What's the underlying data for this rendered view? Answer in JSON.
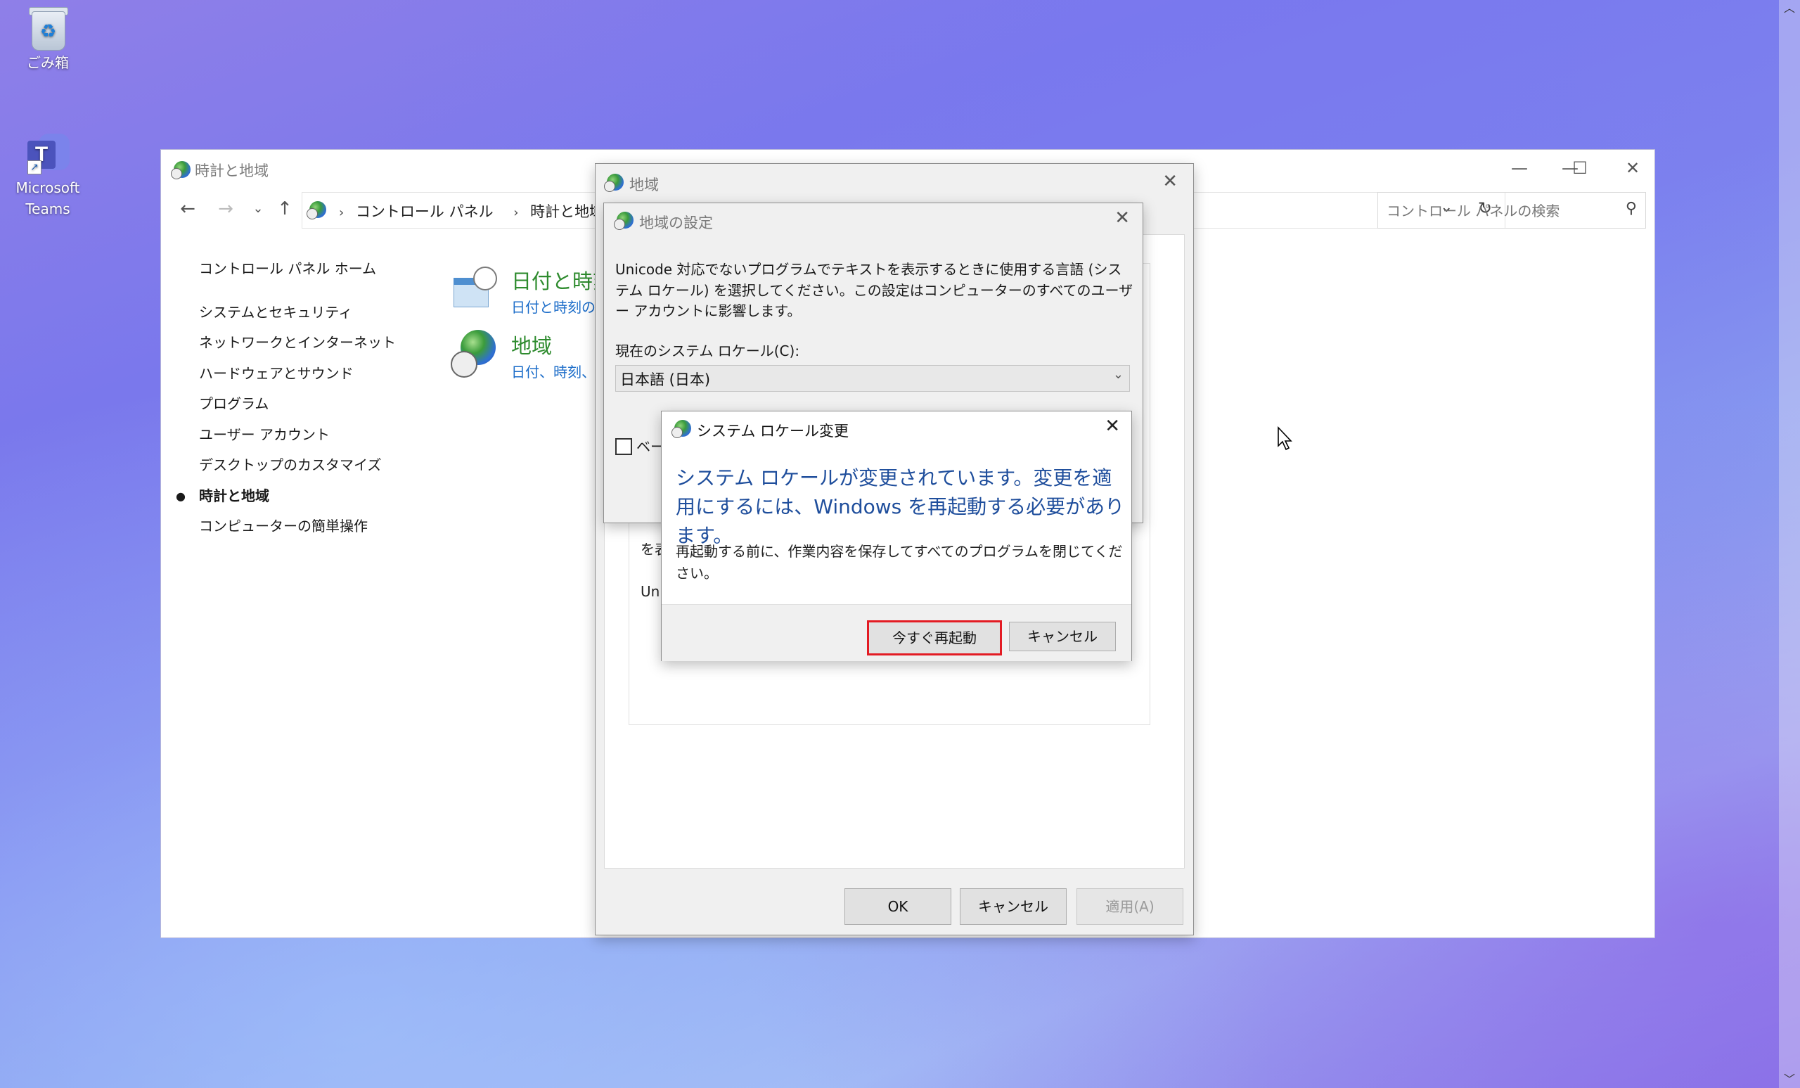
{
  "desktop": {
    "icons": [
      {
        "label": "ごみ箱"
      },
      {
        "label": "Microsoft Teams"
      }
    ]
  },
  "control_panel": {
    "title": "時計と地域",
    "breadcrumbs": [
      "コントロール パネル",
      "時計と地域"
    ],
    "search_placeholder": "コントロール パネルの検索",
    "sidebar": {
      "home": "コントロール パネル ホーム",
      "items": [
        {
          "label": "システムとセキュリティ",
          "active": false
        },
        {
          "label": "ネットワークとインターネット",
          "active": false
        },
        {
          "label": "ハードウェアとサウンド",
          "active": false
        },
        {
          "label": "プログラム",
          "active": false
        },
        {
          "label": "ユーザー アカウント",
          "active": false
        },
        {
          "label": "デスクトップのカスタマイズ",
          "active": false
        },
        {
          "label": "時計と地域",
          "active": true
        },
        {
          "label": "コンピューターの簡単操作",
          "active": false
        }
      ]
    },
    "categories": [
      {
        "title": "日付と時刻",
        "subtitle": "日付と時刻の"
      },
      {
        "title": "地域",
        "subtitle": "日付、時刻、"
      }
    ]
  },
  "region_dialog": {
    "title": "地域",
    "fragments": [
      "を表",
      "Uni"
    ],
    "buttons": {
      "ok": "OK",
      "cancel": "キャンセル",
      "apply": "適用(A)"
    }
  },
  "region_settings_dialog": {
    "title": "地域の設定",
    "description": "Unicode 対応でないプログラムでテキストを表示するときに使用する言語 (システム ロケール) を選択してください。この設定はコンピューターのすべてのユーザー アカウントに影響します。",
    "locale_label": "現在のシステム ロケール(C):",
    "locale_value": "日本語 (日本)",
    "beta_checkbox_label": "ベー",
    "beta_checked": false
  },
  "system_locale_change_dialog": {
    "title": "システム ロケール変更",
    "headline": "システム ロケールが変更されています。変更を適用にするには、Windows を再起動する必要があります。",
    "body": "再起動する前に、作業内容を保存してすべてのプログラムを閉じてください。",
    "buttons": {
      "restart_now": "今すぐ再起動",
      "cancel": "キャンセル"
    },
    "highlight_color": "#e31b23"
  },
  "colors": {
    "link_blue": "#1c6dc9",
    "category_green": "#2e8b2e",
    "headline_blue": "#1f4e9c"
  }
}
